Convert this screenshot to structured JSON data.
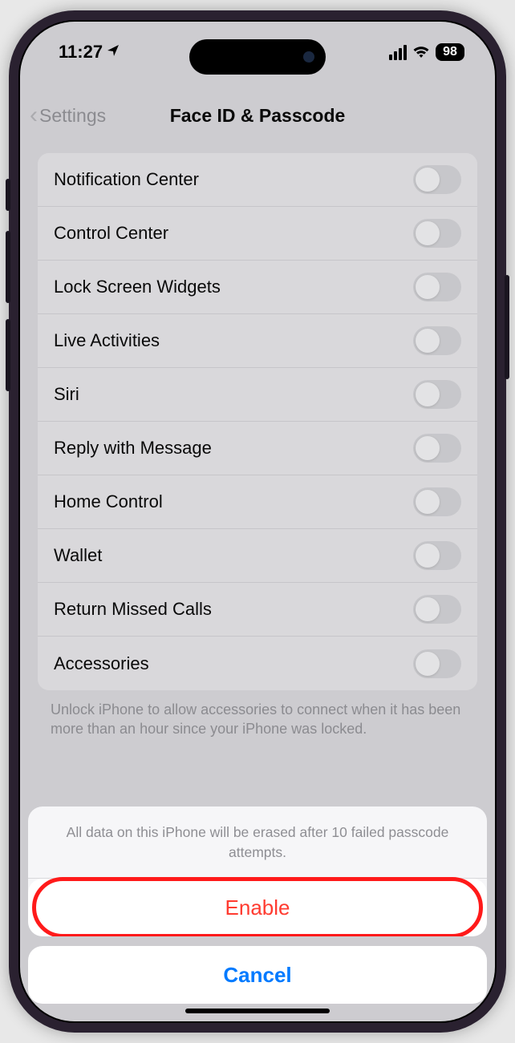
{
  "status": {
    "time": "11:27",
    "location_icon": "➤",
    "battery": "98"
  },
  "nav": {
    "back_label": "Settings",
    "title": "Face ID & Passcode"
  },
  "items": [
    {
      "label": "Notification Center"
    },
    {
      "label": "Control Center"
    },
    {
      "label": "Lock Screen Widgets"
    },
    {
      "label": "Live Activities"
    },
    {
      "label": "Siri"
    },
    {
      "label": "Reply with Message"
    },
    {
      "label": "Home Control"
    },
    {
      "label": "Wallet"
    },
    {
      "label": "Return Missed Calls"
    },
    {
      "label": "Accessories"
    }
  ],
  "footer": "Unlock iPhone to allow accessories to connect when it has been more than an hour since your iPhone was locked.",
  "sheet": {
    "message": "All data on this iPhone will be erased after 10 failed passcode attempts.",
    "enable": "Enable",
    "cancel": "Cancel"
  }
}
